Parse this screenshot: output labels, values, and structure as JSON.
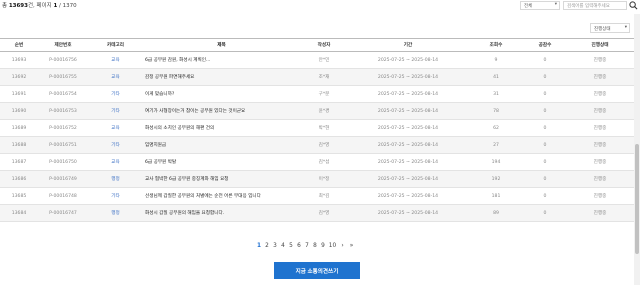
{
  "summary": {
    "prefix": "총 ",
    "total": "13693",
    "unit": "건, 페이지 ",
    "current_page": "1",
    "page_total": " / 1370"
  },
  "search": {
    "filter_value": "전체",
    "placeholder": "검색어를 입력해주세요"
  },
  "status_filter": {
    "value": "진행상태"
  },
  "columns": [
    "순번",
    "제안번호",
    "카테고리",
    "제목",
    "작성자",
    "기간",
    "조회수",
    "공감수",
    "진행상태"
  ],
  "rows": [
    {
      "no": "13693",
      "pid": "P-00016756",
      "cat": "교육",
      "title": "6급 공무원 감원, 화성시 계획인...",
      "author": "안*민",
      "period": "2025-07-25 ~ 2025-08-14",
      "views": "9",
      "agree": "0",
      "status": "진행중"
    },
    {
      "no": "13692",
      "pid": "P-00016755",
      "cat": "교육",
      "title": "감정 공무원 파면해주세요",
      "author": "조*재",
      "period": "2025-07-25 ~ 2025-08-14",
      "views": "41",
      "agree": "0",
      "status": "진행중"
    },
    {
      "no": "13691",
      "pid": "P-00016754",
      "cat": "기타",
      "title": "이게 맞습니까?",
      "author": "구*분",
      "period": "2025-07-25 ~ 2025-08-14",
      "views": "31",
      "agree": "0",
      "status": "진행중"
    },
    {
      "no": "13690",
      "pid": "P-00016753",
      "cat": "기타",
      "title": "여기가 사형장이는거 참이는 공무원 있다는 것이군요",
      "author": "윤*경",
      "period": "2025-07-25 ~ 2025-08-14",
      "views": "78",
      "agree": "0",
      "status": "진행중"
    },
    {
      "no": "13689",
      "pid": "P-00016752",
      "cat": "교육",
      "title": "화성시의 소치인 공무원의 해편 건의",
      "author": "박*현",
      "period": "2025-07-25 ~ 2025-08-14",
      "views": "62",
      "agree": "0",
      "status": "진행중"
    },
    {
      "no": "13688",
      "pid": "P-00016751",
      "cat": "기타",
      "title": "임명지원금",
      "author": "김*영",
      "period": "2025-07-25 ~ 2025-08-14",
      "views": "27",
      "agree": "0",
      "status": "진행중"
    },
    {
      "no": "13687",
      "pid": "P-00016750",
      "cat": "교육",
      "title": "6급 공무원 박탈",
      "author": "김*섭",
      "period": "2025-07-25 ~ 2025-08-14",
      "views": "194",
      "agree": "0",
      "status": "진행중"
    },
    {
      "no": "13686",
      "pid": "P-00016749",
      "cat": "행정",
      "title": "교사 협박한 6급 공무원 중징계와 해임 요청",
      "author": "이*정",
      "period": "2025-07-25 ~ 2025-08-14",
      "views": "192",
      "agree": "0",
      "status": "진행중"
    },
    {
      "no": "13685",
      "pid": "P-00016748",
      "cat": "기타",
      "title": "선생님께 갑질한 공무원의 처벌에는 순전 어른 무대응 입니다",
      "author": "최*김",
      "period": "2025-07-25 ~ 2025-08-14",
      "views": "181",
      "agree": "0",
      "status": "진행중"
    },
    {
      "no": "13684",
      "pid": "P-00016747",
      "cat": "행정",
      "title": "화성시 갑질 공무원의 해임을 요청합니다.",
      "author": "김*영",
      "period": "2025-07-25 ~ 2025-08-14",
      "views": "89",
      "agree": "0",
      "status": "진행중"
    }
  ],
  "pagination": {
    "pages": [
      "1",
      "2",
      "3",
      "4",
      "5",
      "6",
      "7",
      "8",
      "9",
      "10"
    ],
    "active": "1",
    "next": "›",
    "last": "»"
  },
  "write_button": {
    "label": "지금 소통의견쓰기"
  },
  "colors": {
    "accent": "#1f73cf",
    "link": "#3b6fc4"
  }
}
